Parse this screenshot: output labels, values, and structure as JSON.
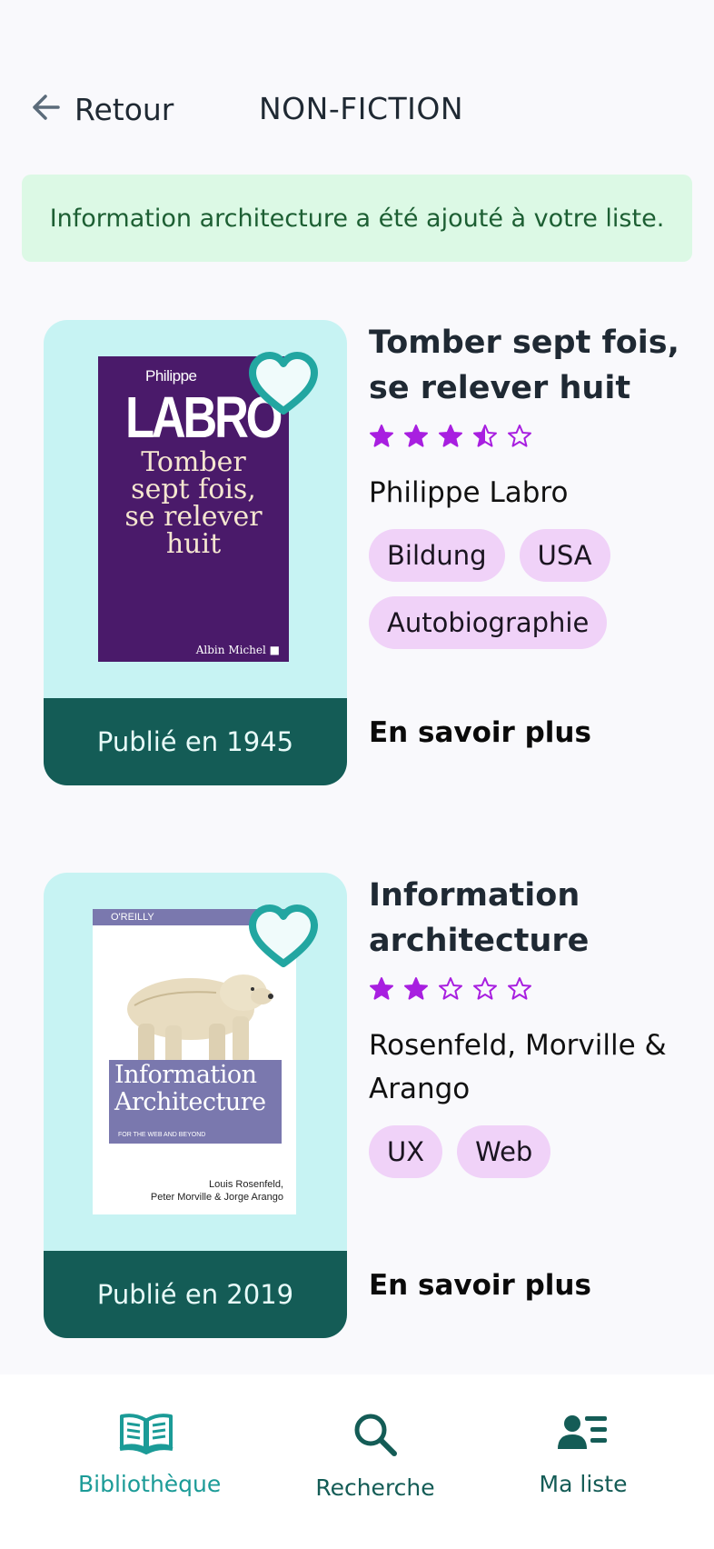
{
  "header": {
    "back_label": "Retour",
    "title": "NON-FICTION"
  },
  "notice": {
    "text": "Information architecture a été ajouté à votre liste."
  },
  "books": [
    {
      "title": "Tomber sept fois, se relever huit",
      "rating": 3.5,
      "rating_max": 5,
      "author": "Philippe Labro",
      "tags": [
        "Bildung",
        "USA",
        "Autobiographie"
      ],
      "published": "Publié en 1945",
      "more_label": "En savoir plus",
      "favorite": true,
      "cover": {
        "author_first": "Philippe",
        "author_last": "LABRO",
        "title_lines": [
          "Tomber",
          "sept fois,",
          "se relever",
          "huit"
        ],
        "publisher": "Albin Michel"
      }
    },
    {
      "title": "Information architecture",
      "rating": 2,
      "rating_max": 5,
      "author": "Rosenfeld, Morville & Arango",
      "tags": [
        "UX",
        "Web"
      ],
      "published": "Publié en 2019",
      "more_label": "En savoir plus",
      "favorite": true,
      "cover": {
        "publisher": "O'REILLY",
        "title_lines": [
          "Information",
          "Architecture"
        ],
        "subtitle": "FOR THE WEB AND BEYOND",
        "authors_lines": [
          "Louis Rosenfeld,",
          "Peter Morville & Jorge Arango"
        ]
      }
    }
  ],
  "nav": {
    "items": [
      {
        "label": "Bibliothèque",
        "icon": "book-open-icon",
        "active": true
      },
      {
        "label": "Recherche",
        "icon": "search-icon",
        "active": false
      },
      {
        "label": "Ma liste",
        "icon": "user-list-icon",
        "active": false
      }
    ]
  },
  "colors": {
    "background": "#f9f9fc",
    "notice_bg": "#dcf9e5",
    "notice_text": "#1d5f33",
    "card_bg": "#c7f3f3",
    "card_footer": "#145c56",
    "heart": "#22a6a1",
    "star": "#a81fe0",
    "tag_bg": "#f0d2f8",
    "nav_active": "#1b9b97",
    "nav_inactive": "#145c56"
  }
}
